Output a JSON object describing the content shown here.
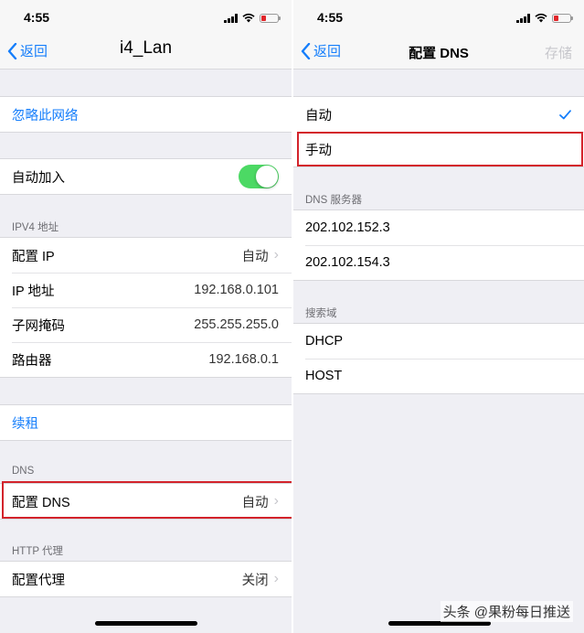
{
  "status": {
    "time": "4:55"
  },
  "colors": {
    "accent": "#157efb",
    "toggle_on": "#4cd964",
    "highlight": "#d3232b",
    "battery_low": "#e0262a"
  },
  "left": {
    "nav": {
      "back_label": "返回",
      "title": "i4_Lan"
    },
    "forget_network": "忽略此网络",
    "auto_join": {
      "label": "自动加入",
      "on": true
    },
    "ipv4": {
      "header": "IPV4 地址",
      "rows": [
        {
          "label": "配置 IP",
          "value": "自动"
        },
        {
          "label": "IP 地址",
          "value": "192.168.0.101"
        },
        {
          "label": "子网掩码",
          "value": "255.255.255.0"
        },
        {
          "label": "路由器",
          "value": "192.168.0.1"
        }
      ]
    },
    "renew_lease": "续租",
    "dns": {
      "header": "DNS",
      "label": "配置 DNS",
      "value": "自动"
    },
    "http_proxy": {
      "header": "HTTP 代理",
      "label": "配置代理",
      "value": "关闭"
    }
  },
  "right": {
    "nav": {
      "back_label": "返回",
      "title": "配置 DNS",
      "save_label": "存储"
    },
    "modes": [
      {
        "label": "自动",
        "selected": true
      },
      {
        "label": "手动",
        "selected": false
      }
    ],
    "dns_servers": {
      "header": "DNS 服务器",
      "items": [
        "202.102.152.3",
        "202.102.154.3"
      ]
    },
    "search_domains": {
      "header": "搜索域",
      "items": [
        "DHCP",
        "HOST"
      ]
    }
  },
  "watermark": "头条 @果粉每日推送",
  "icons": {
    "back": "chevron-left-icon",
    "disclosure": "chevron-right-icon",
    "check": "checkmark-icon",
    "wifi": "wifi-icon",
    "signal": "cellular-signal-icon",
    "battery": "battery-icon"
  }
}
